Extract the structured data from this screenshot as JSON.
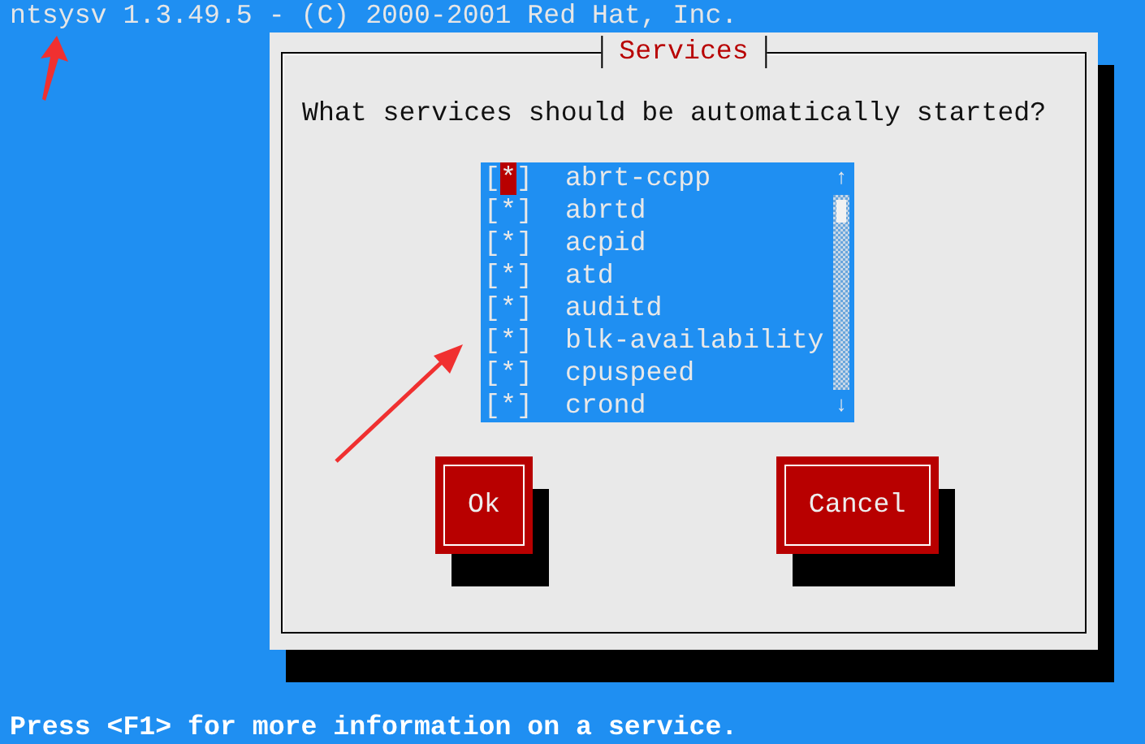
{
  "header": "ntsysv 1.3.49.5 - (C) 2000-2001 Red Hat, Inc.",
  "dialog": {
    "title": "Services",
    "question": "What services should be automatically started?",
    "check_glyphs": {
      "open": "[",
      "mark": "*",
      "close": "]"
    },
    "services": [
      {
        "name": "abrt-ccpp",
        "checked": true,
        "selected": true
      },
      {
        "name": "abrtd",
        "checked": true,
        "selected": false
      },
      {
        "name": "acpid",
        "checked": true,
        "selected": false
      },
      {
        "name": "atd",
        "checked": true,
        "selected": false
      },
      {
        "name": "auditd",
        "checked": true,
        "selected": false
      },
      {
        "name": "blk-availability",
        "checked": true,
        "selected": false
      },
      {
        "name": "cpuspeed",
        "checked": true,
        "selected": false
      },
      {
        "name": "crond",
        "checked": true,
        "selected": false
      }
    ],
    "scrollbar": {
      "up": "↑",
      "down": "↓"
    },
    "buttons": [
      "Ok",
      "Cancel"
    ]
  },
  "status": "Press <F1> for more information on a service."
}
